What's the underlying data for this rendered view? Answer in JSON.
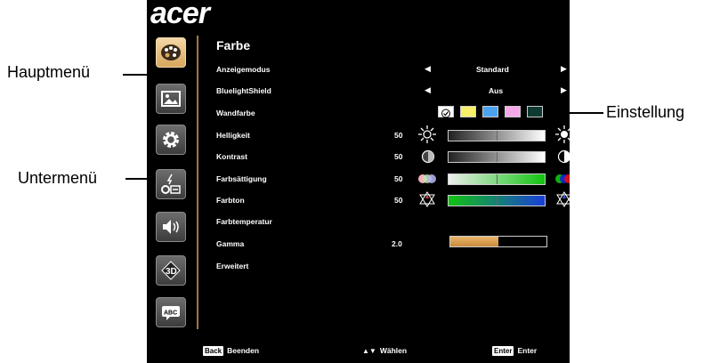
{
  "brand": "acer",
  "menu": {
    "title": "Farbe",
    "tabs": [
      "color-palette-icon",
      "image-icon",
      "gear-icon",
      "input-source-icon",
      "speaker-icon",
      "3d-icon",
      "abc-icon"
    ],
    "rows": [
      {
        "label": "Anzeigemodus",
        "value": "Standard"
      },
      {
        "label": "BluelightShield",
        "value": "Aus"
      },
      {
        "label": "Wandfarbe"
      },
      {
        "label": "Helligkeit",
        "num": "50",
        "level": 50
      },
      {
        "label": "Kontrast",
        "num": "50",
        "level": 50
      },
      {
        "label": "Farbsättigung",
        "num": "50",
        "level": 50
      },
      {
        "label": "Farbton",
        "num": "50",
        "level": 50
      },
      {
        "label": "Farbtemperatur"
      },
      {
        "label": "Gamma",
        "num": "2.0",
        "level": 50
      },
      {
        "label": "Erweitert"
      }
    ],
    "wall_colors": [
      "#ffffff",
      "#f7ef6a",
      "#4aa2f0",
      "#f4a8e8",
      "#0e3a32"
    ]
  },
  "footer": {
    "back_key": "Back",
    "back_label": "Beenden",
    "select_label": "Wählen",
    "enter_key": "Enter",
    "enter_label": "Enter"
  },
  "callouts": {
    "hauptmenu": "Hauptmenü",
    "untermenu": "Untermenü",
    "einstellung": "Einstellung"
  }
}
